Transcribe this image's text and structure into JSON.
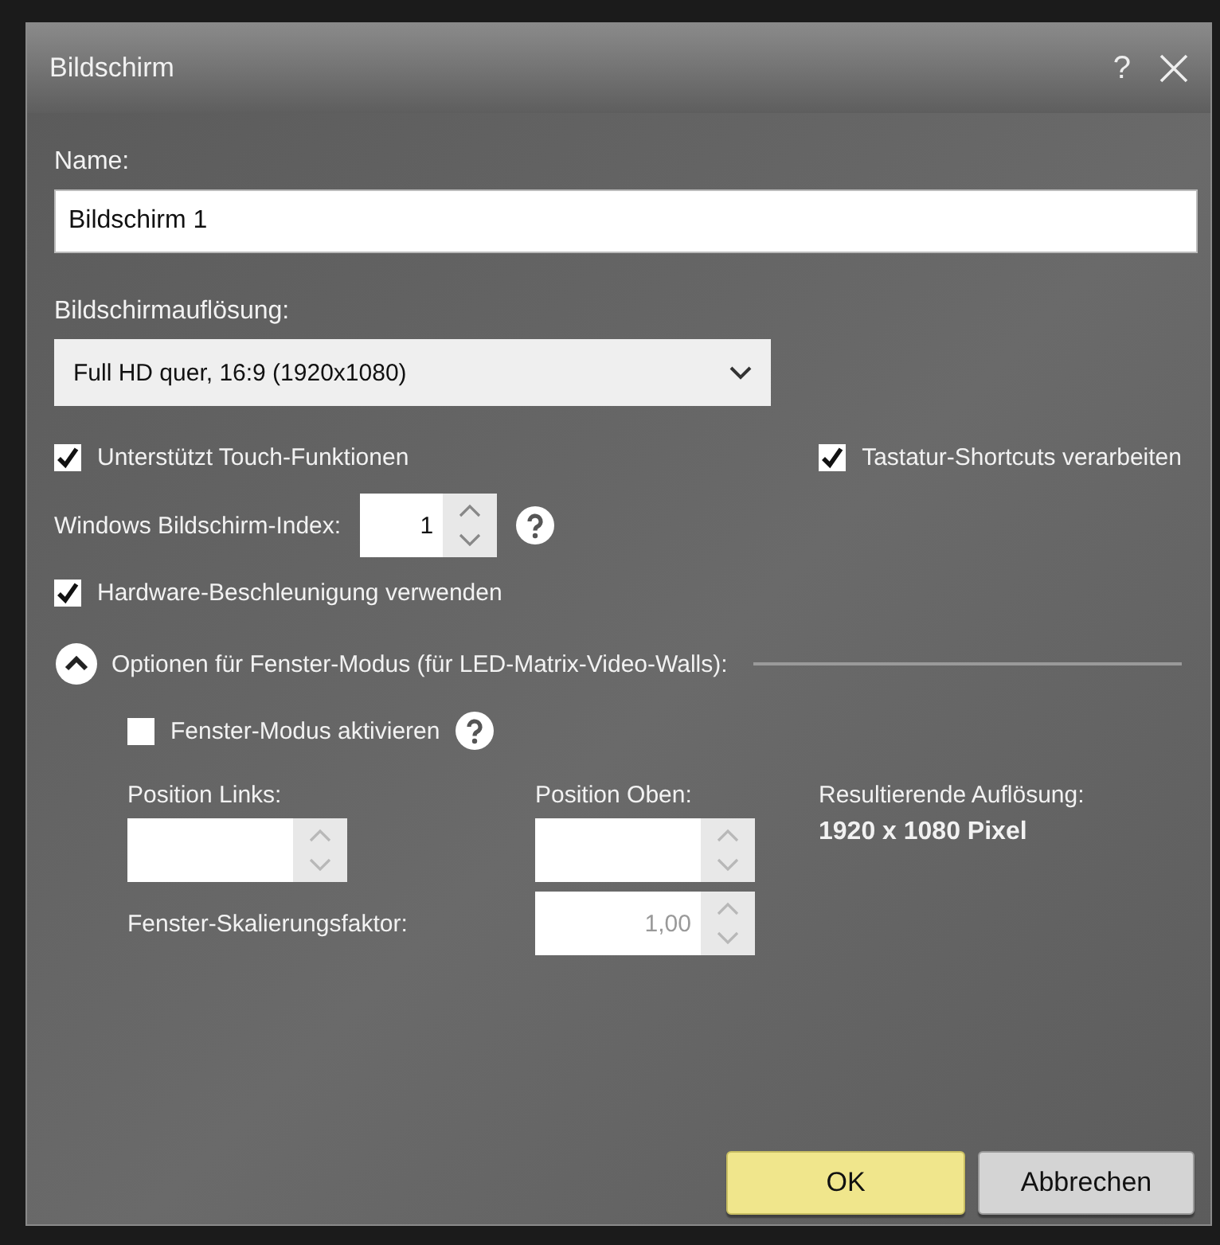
{
  "window": {
    "title": "Bildschirm",
    "help": "?"
  },
  "name": {
    "label": "Name:",
    "value": "Bildschirm 1"
  },
  "resolution": {
    "label": "Bildschirmauflösung:",
    "value": "Full HD quer, 16:9 (1920x1080)"
  },
  "options": [
    {
      "label": "Unterstützt Touch-Funktionen",
      "checked": true
    },
    {
      "label": "Tastatur-Shortcuts verarbeiten",
      "checked": true
    }
  ],
  "screen_index": {
    "label": "Windows Bildschirm-Index:",
    "value": "1",
    "disabled": false
  },
  "hardware_acceleration": {
    "label": "Hardware-Beschleunigung verwenden",
    "checked": true
  },
  "window_mode": {
    "title": "Optionen für Fenster-Modus (für LED-Matrix-Video-Walls):",
    "expanded": true,
    "enable": {
      "label": "Fenster-Modus aktivieren",
      "checked": false
    },
    "position_left": {
      "label": "Position Links:",
      "disabled": true
    },
    "position_top": {
      "label": "Position Oben:",
      "disabled": true
    },
    "result": {
      "label": "Resultierende Auflösung:",
      "value": "1920 x 1080 Pixel"
    },
    "scaling": {
      "label": "Fenster-Skalierungsfaktor:",
      "value": "1,00",
      "disabled": true
    }
  },
  "buttons": [
    {
      "label": "OK",
      "kind": "primary"
    },
    {
      "label": "Abbrechen",
      "kind": "secondary"
    }
  ]
}
